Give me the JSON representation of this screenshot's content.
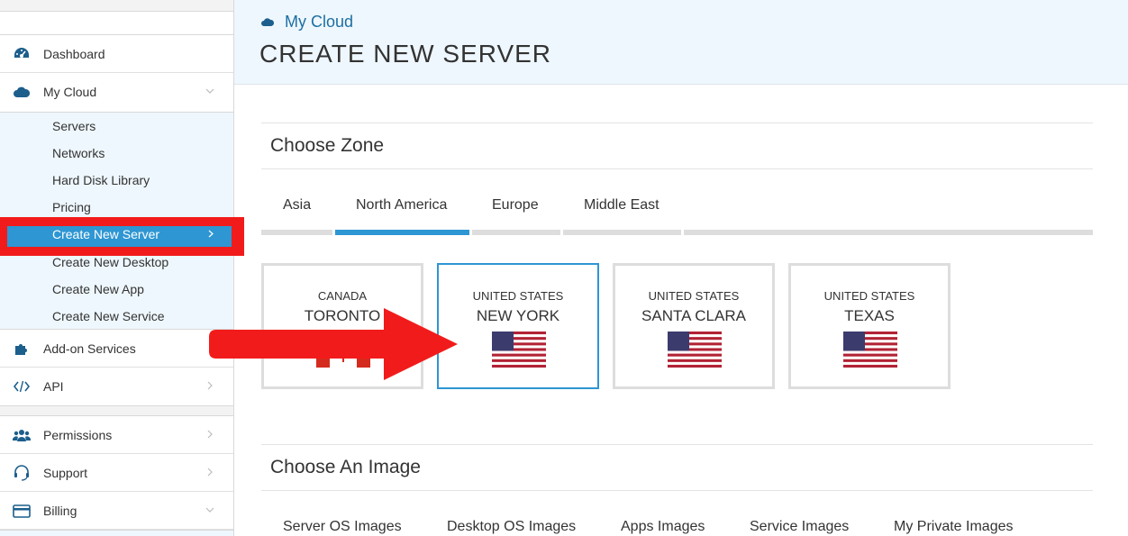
{
  "sidebar": {
    "items": [
      {
        "label": "Dashboard",
        "icon": "dashboard-icon"
      },
      {
        "label": "My Cloud",
        "icon": "cloud-icon"
      },
      {
        "label": "Add-on Services",
        "icon": "puzzle-icon"
      },
      {
        "label": "API",
        "icon": "code-icon"
      },
      {
        "label": "Permissions",
        "icon": "users-icon"
      },
      {
        "label": "Support",
        "icon": "headset-icon"
      },
      {
        "label": "Billing",
        "icon": "credit-card-icon"
      }
    ],
    "submenu": [
      "Servers",
      "Networks",
      "Hard Disk Library",
      "Pricing",
      "Create New Server",
      "Create New Desktop",
      "Create New App",
      "Create New Service"
    ],
    "active_submenu": "Create New Server"
  },
  "header": {
    "breadcrumb": "My Cloud",
    "title": "CREATE NEW SERVER"
  },
  "zone": {
    "title": "Choose Zone",
    "tabs": [
      "Asia",
      "North America",
      "Europe",
      "Middle East"
    ],
    "active_tab": "North America",
    "cards": [
      {
        "country": "CANADA",
        "city": "TORONTO",
        "flag": "canada-flag-icon"
      },
      {
        "country": "UNITED STATES",
        "city": "NEW YORK",
        "flag": "us-flag-icon",
        "selected": true
      },
      {
        "country": "UNITED STATES",
        "city": "SANTA CLARA",
        "flag": "us-flag-icon"
      },
      {
        "country": "UNITED STATES",
        "city": "TEXAS",
        "flag": "us-flag-icon"
      }
    ]
  },
  "image": {
    "title": "Choose An Image",
    "tabs": [
      "Server OS Images",
      "Desktop OS Images",
      "Apps Images",
      "Service Images",
      "My Private Images"
    ]
  },
  "colors": {
    "accent": "#2e96d3",
    "annotation_red": "#f21b1b",
    "header_bg": "#eef7fd"
  }
}
